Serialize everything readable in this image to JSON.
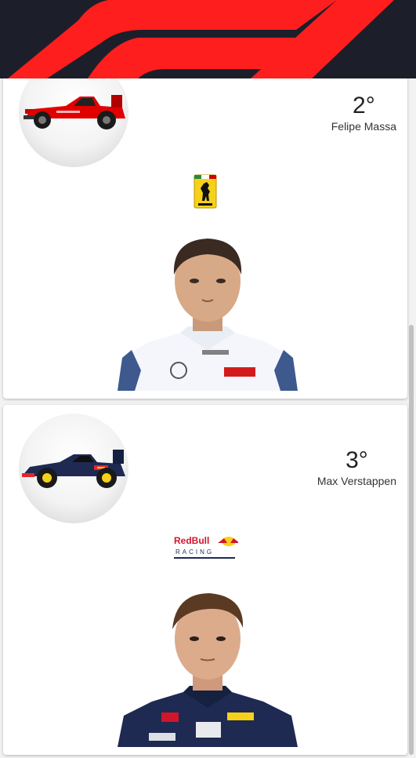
{
  "header": {
    "logo_icon": "formula1-logo-icon",
    "colors": {
      "background": "#1c1f2a",
      "logo_red": "#ff1e1e"
    }
  },
  "drivers": [
    {
      "position": "2°",
      "name": "Felipe Massa",
      "team_logo_icon": "ferrari-logo-icon",
      "car_icon": "ferrari-car-icon",
      "driver_photo_icon": "driver-portrait-icon",
      "team_color": "#d40000"
    },
    {
      "position": "3°",
      "name": "Max Verstappen",
      "team_logo_text": "RedBull",
      "team_logo_subtext": "RACING",
      "team_logo_icon": "redbull-racing-logo-icon",
      "car_icon": "redbull-car-icon",
      "driver_photo_icon": "driver-portrait-icon",
      "team_color": "#1e2a52"
    }
  ]
}
